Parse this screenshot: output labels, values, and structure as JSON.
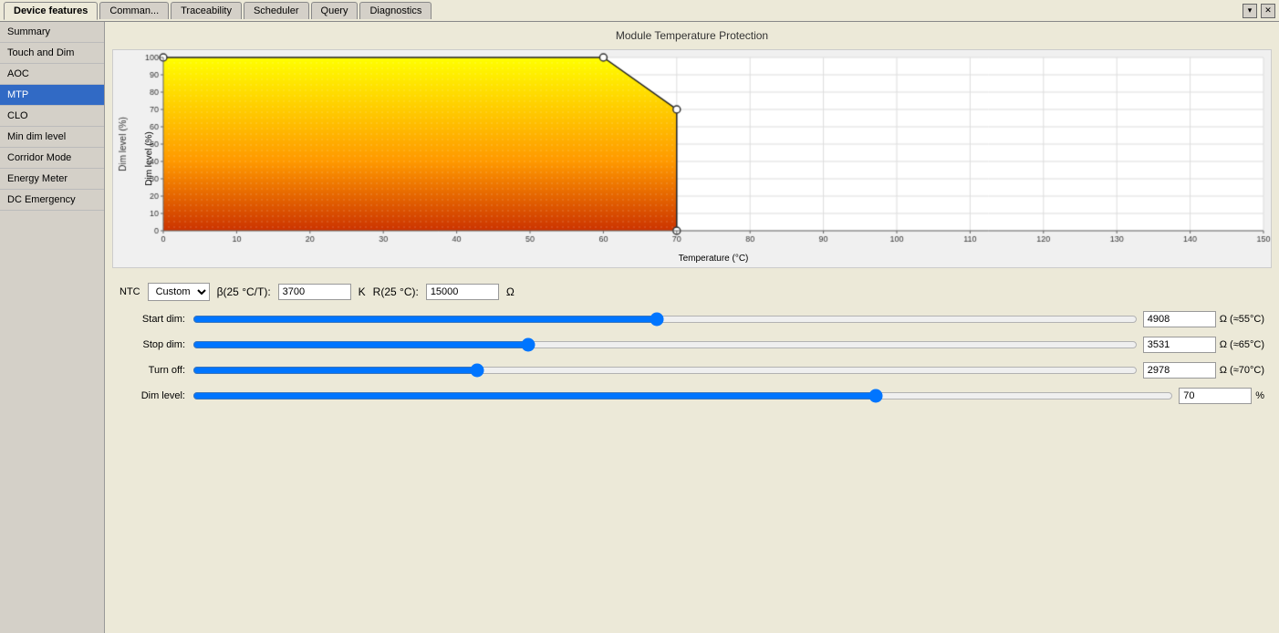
{
  "title": "Module Temperature Protection",
  "tabs": [
    {
      "label": "Device features",
      "active": true
    },
    {
      "label": "Comman...",
      "active": false
    },
    {
      "label": "Traceability",
      "active": false
    },
    {
      "label": "Scheduler",
      "active": false
    },
    {
      "label": "Query",
      "active": false
    },
    {
      "label": "Diagnostics",
      "active": false
    }
  ],
  "sidebar": {
    "items": [
      {
        "label": "Summary",
        "active": false
      },
      {
        "label": "Touch and Dim",
        "active": false
      },
      {
        "label": "AOC",
        "active": false
      },
      {
        "label": "MTP",
        "active": true
      },
      {
        "label": "CLO",
        "active": false
      },
      {
        "label": "Min dim level",
        "active": false
      },
      {
        "label": "Corridor Mode",
        "active": false
      },
      {
        "label": "Energy Meter",
        "active": false
      },
      {
        "label": "DC Emergency",
        "active": false
      }
    ]
  },
  "chart": {
    "y_axis_label": "Dim level (%)",
    "x_axis_label": "Temperature (°C)",
    "y_max": 100,
    "x_max": 150
  },
  "ntc": {
    "label": "NTC",
    "dropdown_value": "Custom",
    "dropdown_options": [
      "Custom"
    ],
    "beta_label": "β(25 °C/T):",
    "beta_value": "3700",
    "beta_unit": "K",
    "r_label": "R(25 °C):",
    "r_value": "15000",
    "r_unit": "Ω"
  },
  "sliders": [
    {
      "label": "Start dim:",
      "value": 4908,
      "min": 0,
      "max": 10000,
      "position": 0.78,
      "unit": "Ω (≈55°C)"
    },
    {
      "label": "Stop dim:",
      "value": 3531,
      "min": 0,
      "max": 10000,
      "position": 0.57,
      "unit": "Ω (≈65°C)"
    },
    {
      "label": "Turn off:",
      "value": 2978,
      "min": 0,
      "max": 10000,
      "position": 0.48,
      "unit": "Ω (≈70°C)"
    },
    {
      "label": "Dim level:",
      "value": 70,
      "min": 0,
      "max": 100,
      "position": 0.63,
      "unit": "%"
    }
  ],
  "colors": {
    "active_tab": "#ece9d8",
    "sidebar_active": "#316ac5",
    "accent": "#316ac5"
  }
}
